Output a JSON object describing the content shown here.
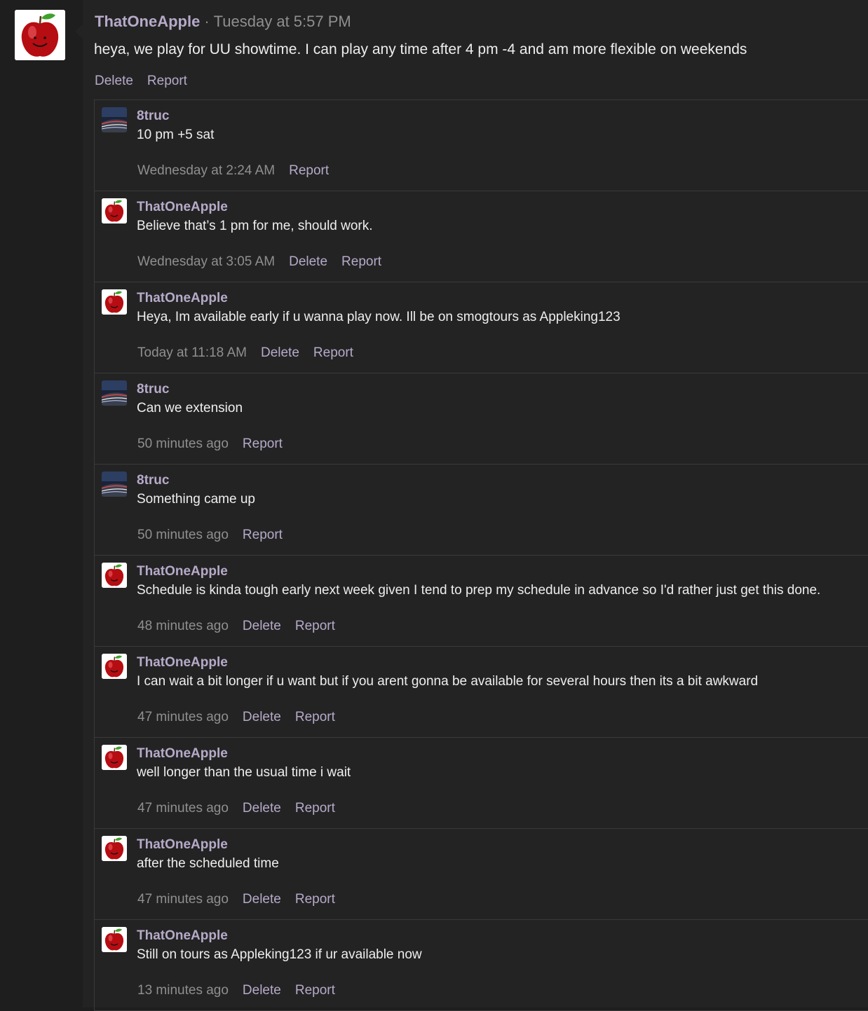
{
  "post": {
    "author": "ThatOneApple",
    "separator": "·",
    "time": "Tuesday at 5:57 PM",
    "text": "heya, we play for UU showtime. I can play any time after 4 pm -4 and am more flexible on weekends",
    "actions": [
      "Delete",
      "Report"
    ]
  },
  "comments": [
    {
      "author": "8truc",
      "avatar": "road",
      "text": "10 pm +5 sat",
      "time": "Wednesday at 2:24 AM",
      "actions": [
        "Report"
      ]
    },
    {
      "author": "ThatOneApple",
      "avatar": "apple",
      "text": "Believe that’s 1 pm for me, should work.",
      "time": "Wednesday at 3:05 AM",
      "actions": [
        "Delete",
        "Report"
      ]
    },
    {
      "author": "ThatOneApple",
      "avatar": "apple",
      "text": "Heya, Im available early if u wanna play now. Ill be on smogtours as Appleking123",
      "time": "Today at 11:18 AM",
      "actions": [
        "Delete",
        "Report"
      ]
    },
    {
      "author": "8truc",
      "avatar": "road",
      "text": "Can we extension",
      "time": "50 minutes ago",
      "actions": [
        "Report"
      ]
    },
    {
      "author": "8truc",
      "avatar": "road",
      "text": "Something came up",
      "time": "50 minutes ago",
      "actions": [
        "Report"
      ]
    },
    {
      "author": "ThatOneApple",
      "avatar": "apple",
      "text": "Schedule is kinda tough early next week given I tend to prep my schedule in advance so I'd rather just get this done.",
      "time": "48 minutes ago",
      "actions": [
        "Delete",
        "Report"
      ]
    },
    {
      "author": "ThatOneApple",
      "avatar": "apple",
      "text": "I can wait a bit longer if u want but if you arent gonna be available for several hours then its a bit awkward",
      "time": "47 minutes ago",
      "actions": [
        "Delete",
        "Report"
      ]
    },
    {
      "author": "ThatOneApple",
      "avatar": "apple",
      "text": "well longer than the usual time i wait",
      "time": "47 minutes ago",
      "actions": [
        "Delete",
        "Report"
      ]
    },
    {
      "author": "ThatOneApple",
      "avatar": "apple",
      "text": "after the scheduled time",
      "time": "47 minutes ago",
      "actions": [
        "Delete",
        "Report"
      ]
    },
    {
      "author": "ThatOneApple",
      "avatar": "apple",
      "text": "Still on tours as Appleking123 if ur available now",
      "time": "13 minutes ago",
      "actions": [
        "Delete",
        "Report"
      ]
    }
  ],
  "colors": {
    "link": "#b6aac9",
    "meta": "#8f8f8f",
    "panel": "#232323",
    "background": "#1e1e1e"
  }
}
